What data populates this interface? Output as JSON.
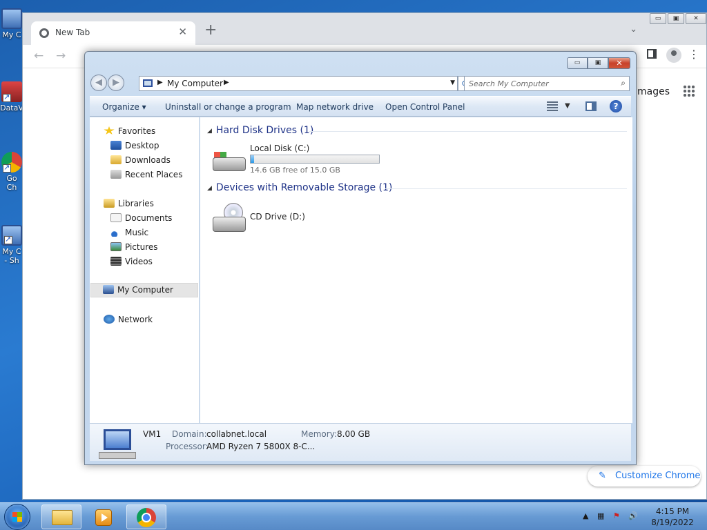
{
  "desktop": {
    "icons": [
      {
        "label": "My C",
        "icon": "my-computer-icon"
      },
      {
        "label": "DataV",
        "icon": "shortcut-icon"
      },
      {
        "label": "Go\nCh",
        "icon": "chrome-shortcut-icon"
      },
      {
        "label": "My C\n- Sh",
        "icon": "my-computer-shortcut-icon"
      }
    ]
  },
  "chrome": {
    "tab_title": "New Tab",
    "tab_close": "✕",
    "new_tab": "+",
    "tab_search": "⌄",
    "back": "←",
    "forward": "→",
    "images_link": "mages",
    "customize_label": "Customize Chrome",
    "pencil": "✎",
    "win_min": "▭",
    "win_max": "▣",
    "win_close": "✕",
    "menu": "⋮"
  },
  "explorer": {
    "caption_min": "▭",
    "caption_max": "▣",
    "caption_close": "✕",
    "back": "◀",
    "forward": "▶",
    "address": {
      "crumb": "My Computer",
      "sep1": "▶",
      "sep2": "▶",
      "drop": "▼"
    },
    "refresh": "⟳",
    "search": {
      "placeholder": "Search My Computer",
      "icon": "⌕"
    },
    "commands": {
      "organize": "Organize ▾",
      "uninstall": "Uninstall or change a program",
      "map_drive": "Map network drive",
      "control_panel": "Open Control Panel",
      "view_drop": "▼",
      "help": "?"
    },
    "nav": {
      "favorites": "Favorites",
      "desktop": "Desktop",
      "downloads": "Downloads",
      "recent": "Recent Places",
      "libraries": "Libraries",
      "documents": "Documents",
      "music": "Music",
      "pictures": "Pictures",
      "videos": "Videos",
      "my_computer": "My Computer",
      "network": "Network"
    },
    "groups": {
      "hdd": "Hard Disk Drives (1)",
      "removable": "Devices with Removable Storage (1)",
      "tri": "◢"
    },
    "drives": {
      "c_name": "Local Disk (C:)",
      "c_free": "14.6 GB free of 15.0 GB",
      "c_used_fraction": 0.027,
      "d_name": "CD Drive (D:)"
    },
    "details": {
      "name": "VM1",
      "domain_label": "Domain:",
      "domain": "collabnet.local",
      "memory_label": "Memory:",
      "memory": "8.00 GB",
      "processor_label": "Processor:",
      "processor": "AMD Ryzen 7 5800X 8-C..."
    }
  },
  "taskbar": {
    "tray_up": "▲",
    "tray_net": "▦",
    "tray_flag": "⚑",
    "tray_vol": "🔊",
    "time": "4:15 PM",
    "date": "8/19/2022"
  },
  "colors": {
    "accent": "#1a73e8",
    "explorer_group": "#1e3287"
  }
}
